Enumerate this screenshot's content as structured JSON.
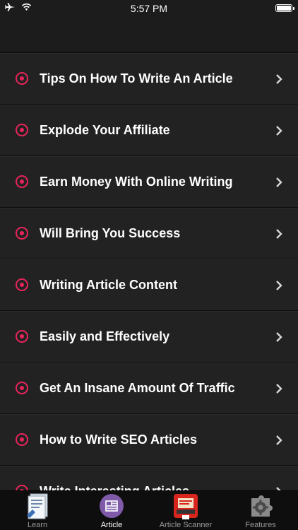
{
  "status": {
    "time": "5:57 PM"
  },
  "items": [
    {
      "label": "Tips On How To Write An Article"
    },
    {
      "label": "Explode Your Affiliate"
    },
    {
      "label": "Earn Money With Online Writing"
    },
    {
      "label": "Will Bring You Success"
    },
    {
      "label": "Writing Article Content"
    },
    {
      "label": "Easily and Effectively"
    },
    {
      "label": "Get An Insane Amount Of Traffic"
    },
    {
      "label": "How to Write SEO Articles"
    },
    {
      "label": "Write Interesting Articles"
    }
  ],
  "tabs": [
    {
      "label": "Learn",
      "icon": "document-icon"
    },
    {
      "label": "Article",
      "icon": "article-icon",
      "active": true
    },
    {
      "label": "Article Scanner",
      "icon": "scanner-icon"
    },
    {
      "label": "Features",
      "icon": "puzzle-gear-icon"
    }
  ],
  "colors": {
    "accent": "#e8245a",
    "background": "#1c1c1c",
    "row": "#222222"
  }
}
